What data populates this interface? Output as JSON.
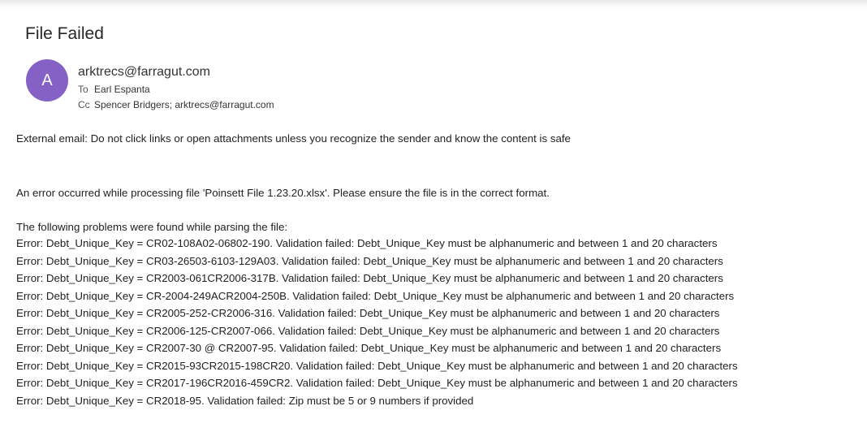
{
  "email": {
    "subject": "File Failed",
    "avatar_initial": "A",
    "avatar_color": "#8661c5",
    "sender": "arktrecs@farragut.com",
    "to_label": "To",
    "to_value": "Earl Espanta",
    "cc_label": "Cc",
    "cc_value": "Spencer Bridgers; arktrecs@farragut.com"
  },
  "body": {
    "warning": "External email: Do not click links or open attachments unless you recognize the sender and know the content is safe",
    "intro": "An error occurred while processing file 'Poinsett File 1.23.20.xlsx'. Please ensure the file is in the correct format.",
    "problems_heading": "The following problems were found while parsing the file:",
    "errors": [
      "Error: Debt_Unique_Key = CR02-108A02-06802-190. Validation failed: Debt_Unique_Key must be alphanumeric and between 1 and 20 characters",
      "Error: Debt_Unique_Key = CR03-26503-6103-129A03. Validation failed: Debt_Unique_Key must be alphanumeric and between 1 and 20 characters",
      "Error: Debt_Unique_Key = CR2003-061CR2006-317B. Validation failed: Debt_Unique_Key must be alphanumeric and between 1 and 20 characters",
      "Error: Debt_Unique_Key = CR-2004-249ACR2004-250B. Validation failed: Debt_Unique_Key must be alphanumeric and between 1 and 20 characters",
      "Error: Debt_Unique_Key = CR2005-252-CR2006-316. Validation failed: Debt_Unique_Key must be alphanumeric and between 1 and 20 characters",
      "Error: Debt_Unique_Key = CR2006-125-CR2007-066. Validation failed: Debt_Unique_Key must be alphanumeric and between 1 and 20 characters",
      "Error: Debt_Unique_Key = CR2007-30 @ CR2007-95. Validation failed: Debt_Unique_Key must be alphanumeric and between 1 and 20 characters",
      "Error: Debt_Unique_Key = CR2015-93CR2015-198CR20. Validation failed: Debt_Unique_Key must be alphanumeric and between 1 and 20 characters",
      "Error: Debt_Unique_Key = CR2017-196CR2016-459CR2. Validation failed: Debt_Unique_Key must be alphanumeric and between 1 and 20 characters",
      "Error: Debt_Unique_Key = CR2018-95. Validation failed: Zip must be 5 or 9 numbers if provided"
    ]
  }
}
